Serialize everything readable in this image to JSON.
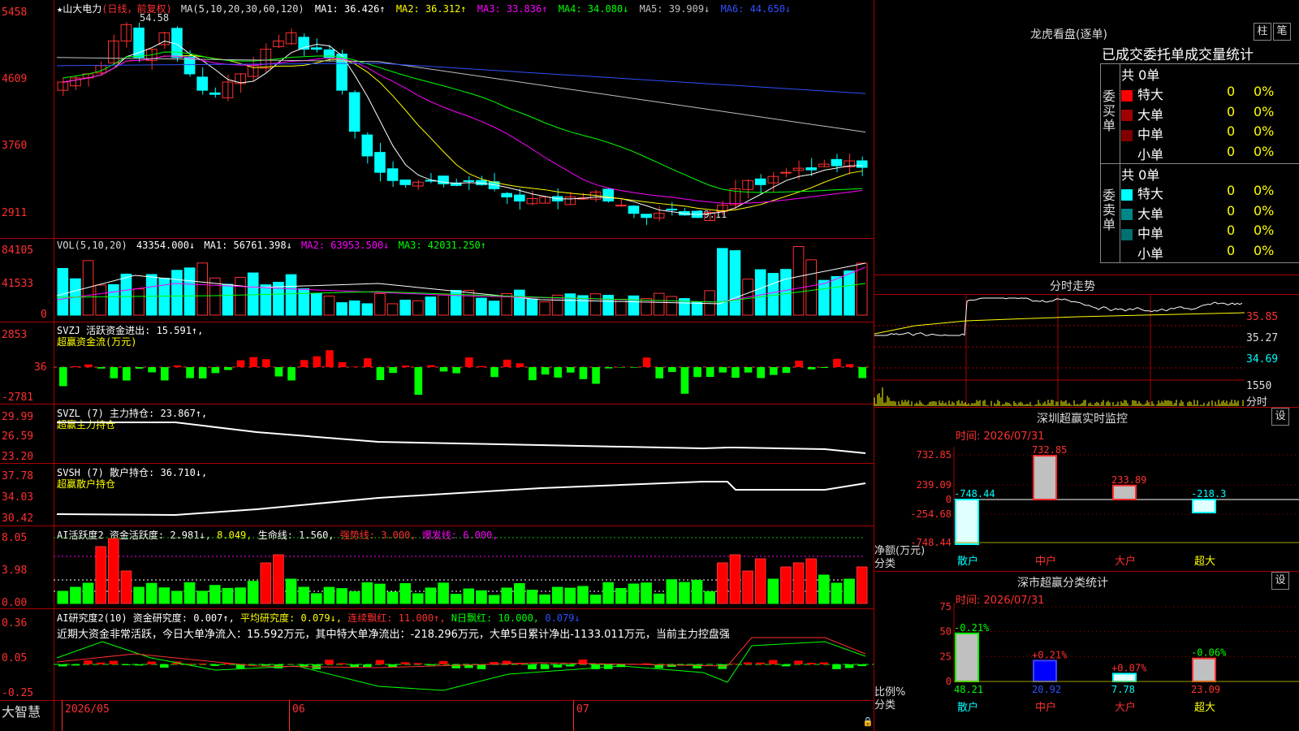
{
  "main": {
    "title": "★山大电力",
    "period": "(日线，前复权)",
    "ma_params": "MA(5,10,20,30,60,120)",
    "ma_values": [
      {
        "label": "MA1: 36.426↑",
        "color": "#ffffff"
      },
      {
        "label": "MA2: 36.312↑",
        "color": "#ffff00"
      },
      {
        "label": "MA3: 33.836↑",
        "color": "#ff00ff"
      },
      {
        "label": "MA4: 34.080↓",
        "color": "#00ff00"
      },
      {
        "label": "MA5: 39.909↓",
        "color": "#c0c0c0"
      },
      {
        "label": "MA6: 44.650↓",
        "color": "#3050ff"
      }
    ],
    "y_ticks": [
      "5458",
      "4609",
      "3760",
      "2911"
    ],
    "high_marker": "54.58",
    "low_marker": "←29.11"
  },
  "volume": {
    "header": "VOL(5,10,20)",
    "value": "43354.000↓",
    "ma_values": [
      {
        "label": "MA1: 56761.398↓",
        "color": "#ffffff"
      },
      {
        "label": "MA2: 63953.500↓",
        "color": "#ff00ff"
      },
      {
        "label": "MA3: 42031.250↑",
        "color": "#00ff00"
      }
    ],
    "y_ticks": [
      "84105",
      "41533",
      "0"
    ]
  },
  "svzj": {
    "header": "SVZJ  活跃资金进出: 15.591↑,",
    "subheader": "超赢资金流(万元)",
    "y_ticks": [
      "2853",
      "36",
      "-2781"
    ]
  },
  "svzl": {
    "header": "SVZL (7) 主力持仓: 23.867↑,",
    "subheader": "超赢主力持仓",
    "y_ticks": [
      "29.99",
      "26.59",
      "23.20"
    ]
  },
  "svsh": {
    "header": "SVSH (7) 散户持仓: 36.710↓,",
    "subheader": "超赢散户持仓",
    "y_ticks": [
      "37.78",
      "34.03",
      "30.42"
    ]
  },
  "ai_activity": {
    "header_parts": [
      {
        "label": "AI活跃度2 资金活跃度: 2.981↓,",
        "color": "#ffffff"
      },
      {
        "label": " 8.049,",
        "color": "#ffff00"
      },
      {
        "label": " 生命线: 1.560,",
        "color": "#ffffff"
      },
      {
        "label": " 强势线: 3.000,",
        "color": "#ff3030"
      },
      {
        "label": " 爆发线: 6.000,",
        "color": "#ff00ff"
      }
    ],
    "y_ticks": [
      "8.05",
      "3.98",
      "0.00"
    ]
  },
  "ai_research": {
    "header_parts": [
      {
        "label": "AI研究度2(10) 资金研究度: 0.007↑,",
        "color": "#ffffff"
      },
      {
        "label": " 平均研究度: 0.079↓,",
        "color": "#ffff00"
      },
      {
        "label": " 连续飘红: 11.000↑,",
        "color": "#ff3030"
      },
      {
        "label": " N日飘红: 10.000,",
        "color": "#00ff00"
      },
      {
        "label": " 0.079↓",
        "color": "#3050ff"
      }
    ],
    "summary": "近期大资金非常活跃，今日大单净流入：15.592万元，其中特大单净流出：-218.296万元，大单5日累计净出-1133.011万元，当前主力控盘强",
    "y_ticks": [
      "0.36",
      "0.05",
      "-0.25"
    ]
  },
  "bottom_axis": {
    "brand": "大智慧",
    "months": [
      "2026/05",
      "06",
      "07"
    ]
  },
  "dragon_tiger": {
    "title": "龙虎看盘(逐单)",
    "btn_pillar": "柱",
    "btn_pen": "笔",
    "subtitle": "已成交委托单成交量统计",
    "buy_label": "委买单",
    "sell_label": "委卖单",
    "buy_total": "共 0单",
    "sell_total": "共 0单",
    "buy_rows": [
      {
        "name": "特大",
        "count": "0",
        "pct": "0%",
        "color": "#ff0000"
      },
      {
        "name": "大单",
        "count": "0",
        "pct": "0%",
        "color": "#a00000"
      },
      {
        "name": "中单",
        "count": "0",
        "pct": "0%",
        "color": "#800000"
      },
      {
        "name": "小单",
        "count": "0",
        "pct": "0%",
        "color": ""
      }
    ],
    "sell_rows": [
      {
        "name": "特大",
        "count": "0",
        "pct": "0%",
        "color": "#00ffff"
      },
      {
        "name": "大单",
        "count": "0",
        "pct": "0%",
        "color": "#008888"
      },
      {
        "name": "中单",
        "count": "0",
        "pct": "0%",
        "color": "#007070"
      },
      {
        "name": "小单",
        "count": "0",
        "pct": "0%",
        "color": ""
      }
    ]
  },
  "intraday": {
    "title": "分时走势",
    "price_ticks": [
      "35.85",
      "35.27",
      "34.69"
    ],
    "vol_ticks": [
      "1550",
      "分时"
    ]
  },
  "realtime_monitor": {
    "title": "深圳超赢实时监控",
    "btn_settings": "设",
    "time": "时间: 2026/07/31",
    "y_ticks": [
      "732.85",
      "239.09",
      "0",
      "-254.68",
      "-748.44"
    ],
    "bar_labels": [
      "-748.44",
      "732.85",
      "233.89",
      "-218.3"
    ],
    "categories": [
      "散户",
      "中户",
      "大户",
      "超大"
    ],
    "y_caption": "净额(万元)",
    "x_caption": "分类",
    "values": [
      -748.44,
      732.85,
      233.89,
      -218.3
    ]
  },
  "class_stats": {
    "title": "深市超赢分类统计",
    "btn_settings": "设",
    "time": "时间: 2026/07/31",
    "y_ticks": [
      "75",
      "50",
      "25",
      "0"
    ],
    "top_labels": [
      "-0.21%",
      "+0.21%",
      "+0.07%",
      "-0.06%"
    ],
    "bottom_values": [
      "48.21",
      "20.92",
      "7.78",
      "23.09"
    ],
    "categories": [
      "散户",
      "中户",
      "大户",
      "超大"
    ],
    "y_caption": "比例%",
    "x_caption": "分类",
    "values": [
      48.21,
      20.92,
      7.78,
      23.09
    ]
  }
}
